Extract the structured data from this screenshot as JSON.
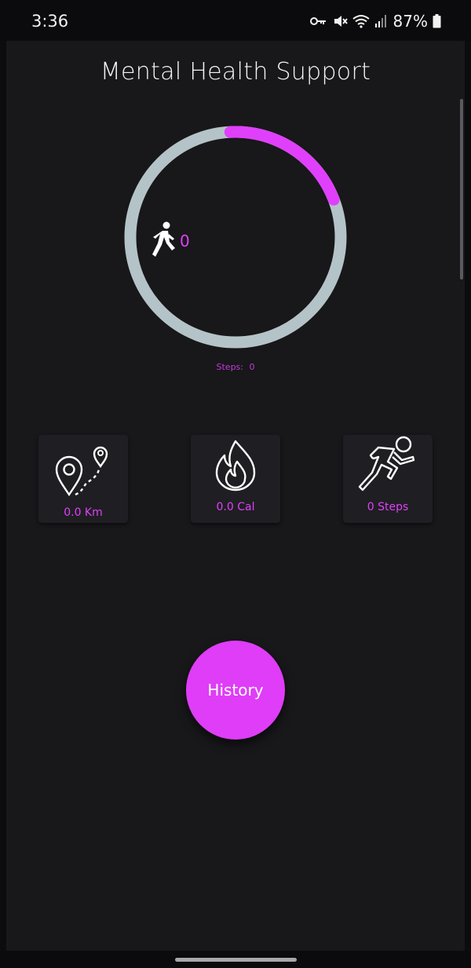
{
  "status_bar": {
    "time": "3:36",
    "battery": "87%",
    "icons": [
      "key-icon",
      "mute-icon",
      "wifi-icon",
      "signal-icon",
      "battery-icon"
    ]
  },
  "app": {
    "title": "Mental Health Support",
    "ring": {
      "count": "0",
      "progress_fraction": 0.2,
      "steps_label": "Steps:",
      "steps_value": "0",
      "icon": "walking-person-icon"
    },
    "cards": [
      {
        "icon": "map-route-icon",
        "label": "0.0 Km"
      },
      {
        "icon": "flame-icon",
        "label": "0.0 Cal"
      },
      {
        "icon": "running-person-icon",
        "label": "0 Steps"
      }
    ],
    "history_button": "History"
  },
  "colors": {
    "accent": "#e040fb",
    "ring_track": "#b4c3c7",
    "background": "#18171a",
    "card": "#1f1e22"
  }
}
